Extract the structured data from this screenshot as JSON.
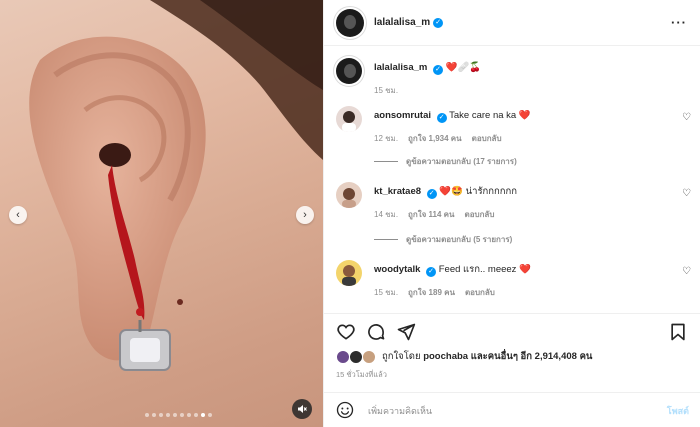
{
  "post": {
    "author": "lalalalisa_m",
    "caption_emojis": "❤️🩹🍒",
    "caption_time": "15 ชม.",
    "carousel": {
      "total_slides": 10,
      "active_slide": 9
    }
  },
  "comments": [
    {
      "user": "aonsomrutai",
      "verified": true,
      "text": "Take care na ka",
      "emoji": "❤️",
      "time": "12 ชม.",
      "likes": "ถูกใจ 1,934 คน",
      "reply": "ตอบกลับ",
      "replies_label": "ดูข้อความตอบกลับ (17 รายการ)"
    },
    {
      "user": "kt_kratae8",
      "verified": true,
      "text": "น่ารักกกกกก",
      "emoji": "❤️🤩",
      "time": "14 ชม.",
      "likes": "ถูกใจ 114 คน",
      "reply": "ตอบกลับ",
      "replies_label": "ดูข้อความตอบกลับ (5 รายการ)"
    },
    {
      "user": "woodytalk",
      "verified": true,
      "text": "Feed แรก.. meeez",
      "emoji": "❤️",
      "time": "15 ชม.",
      "likes": "ถูกใจ 189 คน",
      "reply": "ตอบกลับ"
    }
  ],
  "likes_summary": {
    "prefix": "ถูกใจโดย",
    "user": "poochaba",
    "middle": "และคนอื่นๆ อีก",
    "count": "2,914,408",
    "suffix": "คน"
  },
  "posted_time": "15 ชั่วโมงที่แล้ว",
  "composer": {
    "placeholder": "เพิ่มความคิดเห็น",
    "post_label": "โพสต์"
  },
  "icons": [
    "chevron-left-icon",
    "chevron-right-icon",
    "mute-icon",
    "verified-icon",
    "more-icon",
    "heart-icon",
    "comment-icon",
    "share-icon",
    "bookmark-icon",
    "emoji-icon"
  ],
  "colors": {
    "accent": "#0095f6",
    "like_red": "#ed1c3a",
    "muted_text": "#8e8e8e",
    "post_disabled": "#b2dffc"
  }
}
